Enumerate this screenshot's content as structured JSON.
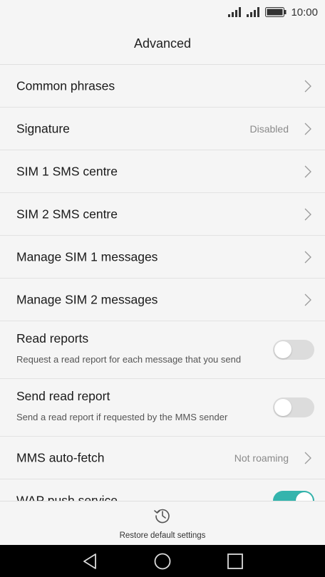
{
  "status_bar": {
    "time": "10:00"
  },
  "header": {
    "title": "Advanced"
  },
  "rows": [
    {
      "label": "Common phrases"
    },
    {
      "label": "Signature",
      "value": "Disabled"
    },
    {
      "label": "SIM 1 SMS centre"
    },
    {
      "label": "SIM 2 SMS centre"
    },
    {
      "label": "Manage SIM 1 messages"
    },
    {
      "label": "Manage SIM 2 messages"
    },
    {
      "label": "Read reports",
      "sub": "Request a read report for each message that you send",
      "toggle": false
    },
    {
      "label": "Send read report",
      "sub": "Send a read report if requested by the MMS sender",
      "toggle": false
    },
    {
      "label": "MMS auto-fetch",
      "value": "Not roaming"
    },
    {
      "label": "WAP push service",
      "toggle": true
    }
  ],
  "footer": {
    "restore_label": "Restore default settings"
  },
  "colors": {
    "accent": "#34b4ad",
    "background": "#f5f5f5"
  }
}
